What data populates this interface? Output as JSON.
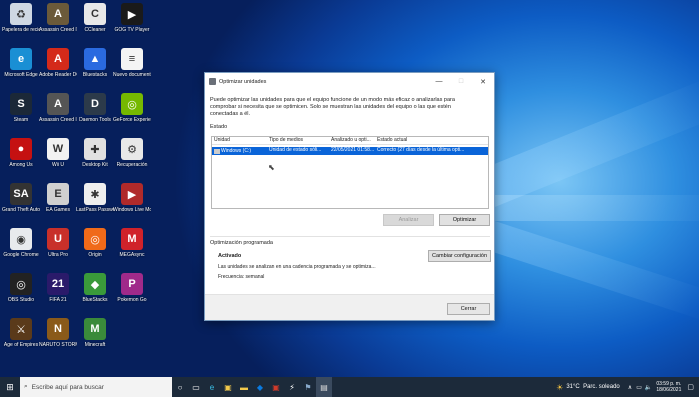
{
  "desktop_icons": [
    {
      "label": "Papelera de reciclaje",
      "color": "#cfd8e3",
      "glyph": "♻"
    },
    {
      "label": "Microsoft Edge",
      "color": "#1a8fd4",
      "glyph": "e"
    },
    {
      "label": "Steam",
      "color": "#1b2838",
      "glyph": "S"
    },
    {
      "label": "Among Us",
      "color": "#c51111",
      "glyph": "●"
    },
    {
      "label": "Grand Theft Auto SA",
      "color": "#333",
      "glyph": "SA"
    },
    {
      "label": "Google Chrome",
      "color": "#e8eaed",
      "glyph": "◉"
    },
    {
      "label": "OBS Studio",
      "color": "#222",
      "glyph": "◎"
    },
    {
      "label": "Age of Empires",
      "color": "#5a3a1a",
      "glyph": "⚔"
    },
    {
      "label": "Assassin Creed IV",
      "color": "#6b5a3a",
      "glyph": "A"
    },
    {
      "label": "Adobe Reader DC",
      "color": "#d42a1a",
      "glyph": "A"
    },
    {
      "label": "Assassin Creed II",
      "color": "#555",
      "glyph": "A"
    },
    {
      "label": "Wii U",
      "color": "#f2f2f2",
      "glyph": "W"
    },
    {
      "label": "EA Games",
      "color": "#d0d0d0",
      "glyph": "E"
    },
    {
      "label": "Ultra Pro",
      "color": "#c8302a",
      "glyph": "U"
    },
    {
      "label": "FIFA 21",
      "color": "#2a1a6a",
      "glyph": "21"
    },
    {
      "label": "NARUTO STORM",
      "color": "#8a5a1a",
      "glyph": "N"
    },
    {
      "label": "CCleaner",
      "color": "#e8e8e8",
      "glyph": "C"
    },
    {
      "label": "Bluestacks",
      "color": "#2a6ae0",
      "glyph": "▲"
    },
    {
      "label": "Daemon Tools",
      "color": "#2c3a4a",
      "glyph": "D"
    },
    {
      "label": "Desktop Kit",
      "color": "#e0e0e0",
      "glyph": "✚"
    },
    {
      "label": "LastPass Password",
      "color": "#eeeeee",
      "glyph": "✱"
    },
    {
      "label": "Origin",
      "color": "#f06a1a",
      "glyph": "◎"
    },
    {
      "label": "BlueStacks",
      "color": "#3a9a3a",
      "glyph": "◆"
    },
    {
      "label": "Minecraft",
      "color": "#3a8a3a",
      "glyph": "M"
    },
    {
      "label": "GOG TV Player",
      "color": "#1a1a1a",
      "glyph": "▶"
    },
    {
      "label": "Nuevo documento",
      "color": "#f4f4f4",
      "glyph": "≡"
    },
    {
      "label": "GeForce Experience",
      "color": "#76b900",
      "glyph": "◎"
    },
    {
      "label": "Recuperación",
      "color": "#e8e8e8",
      "glyph": "⚙"
    },
    {
      "label": "Windows Live Movie",
      "color": "#b02a2a",
      "glyph": "▶"
    },
    {
      "label": "MEGAsync",
      "color": "#d0222a",
      "glyph": "M"
    },
    {
      "label": "Pokemon Go",
      "color": "#a02a8a",
      "glyph": "P"
    }
  ],
  "window": {
    "title": "Optimizar unidades",
    "minimize": "—",
    "maximize": "□",
    "close": "✕",
    "description": "Puede optimizar las unidades para que el equipo funcione de un modo más eficaz o analizarlas para comprobar si necesita que se optimicen. Solo se muestran las unidades del equipo o las que estén conectadas a él.",
    "status_label": "Estado",
    "columns": [
      "Unidad",
      "Tipo de medios",
      "Analizado u opti...",
      "Estado actual"
    ],
    "rows": [
      [
        "Windows (C:)",
        "Unidad de estado sóli...",
        "22/05/2021 01:58...",
        "Correcto (27 días desde la última opti..."
      ]
    ],
    "analyze_button": "Analizar",
    "optimize_button": "Optimizar",
    "scheduled_title": "Optimización programada",
    "scheduled_state": "Activado",
    "scheduled_desc": "Las unidades se analizan en una cadencia programada y se optimiza...",
    "frequency": "Frecuencia: semanal",
    "change_button": "Cambiar configuración",
    "close_button": "Cerrar"
  },
  "taskbar": {
    "search_placeholder": "Escribe aquí para buscar",
    "weather": "31°C  Parc. soleado",
    "time": "03:59 p. m.",
    "date": "18/06/2021"
  }
}
